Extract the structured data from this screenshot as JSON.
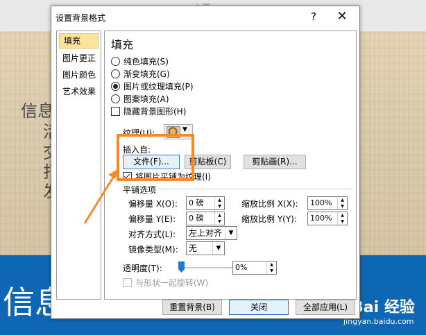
{
  "background": {
    "ribbon_fragment": "入匹",
    "slide_text_lines": [
      "信息",
      "活",
      "交",
      "打",
      "发"
    ],
    "slide_big_text": "信息"
  },
  "watermark": {
    "main": "Bai 经验",
    "sub": "jingyan.baidu.com"
  },
  "dialog": {
    "title": "设置背景格式",
    "help": "?",
    "close": "✕",
    "nav": {
      "items": [
        {
          "label": "填充",
          "selected": true
        },
        {
          "label": "图片更正",
          "selected": false
        },
        {
          "label": "图片颜色",
          "selected": false
        },
        {
          "label": "艺术效果",
          "selected": false
        }
      ]
    },
    "fill": {
      "heading": "填充",
      "options": [
        {
          "label": "纯色填充(S)",
          "checked": false
        },
        {
          "label": "渐变填充(G)",
          "checked": false
        },
        {
          "label": "图片或纹理填充(P)",
          "checked": true
        },
        {
          "label": "图案填充(A)",
          "checked": false
        }
      ],
      "hide_bg_graphics": "隐藏背景图形(H)",
      "texture_label": "纹理(U):",
      "texture_swatch": "texture-swatch",
      "insert_from_label": "插入自:",
      "buttons": {
        "file": "文件(F)...",
        "clipboard": "剪贴板(C)",
        "clipart": "剪贴画(R)..."
      },
      "tile_checkbox": "将图片平铺为纹理(I)",
      "tile_checked": true,
      "tiling_options_title": "平铺选项",
      "offset_x_label": "偏移量 X(O):",
      "offset_x_value": "0 磅",
      "offset_y_label": "偏移量 Y(E):",
      "offset_y_value": "0 磅",
      "scale_x_label": "缩放比例 X(X):",
      "scale_x_value": "100%",
      "scale_y_label": "缩放比例 Y(Y):",
      "scale_y_value": "100%",
      "align_label": "对齐方式(L):",
      "align_value": "左上对齐",
      "mirror_label": "镜像类型(M):",
      "mirror_value": "无",
      "transparency_label": "透明度(T):",
      "transparency_value": "0%",
      "transparency_level": 0,
      "rotate_with_shape": "与形状一起旋转(W)",
      "rotate_checked": false
    },
    "footer": {
      "reset": "重置背景(B)",
      "close": "关闭",
      "apply_all": "全部应用(L)"
    }
  },
  "annotation": {
    "highlight_color": "#f58a2a"
  }
}
